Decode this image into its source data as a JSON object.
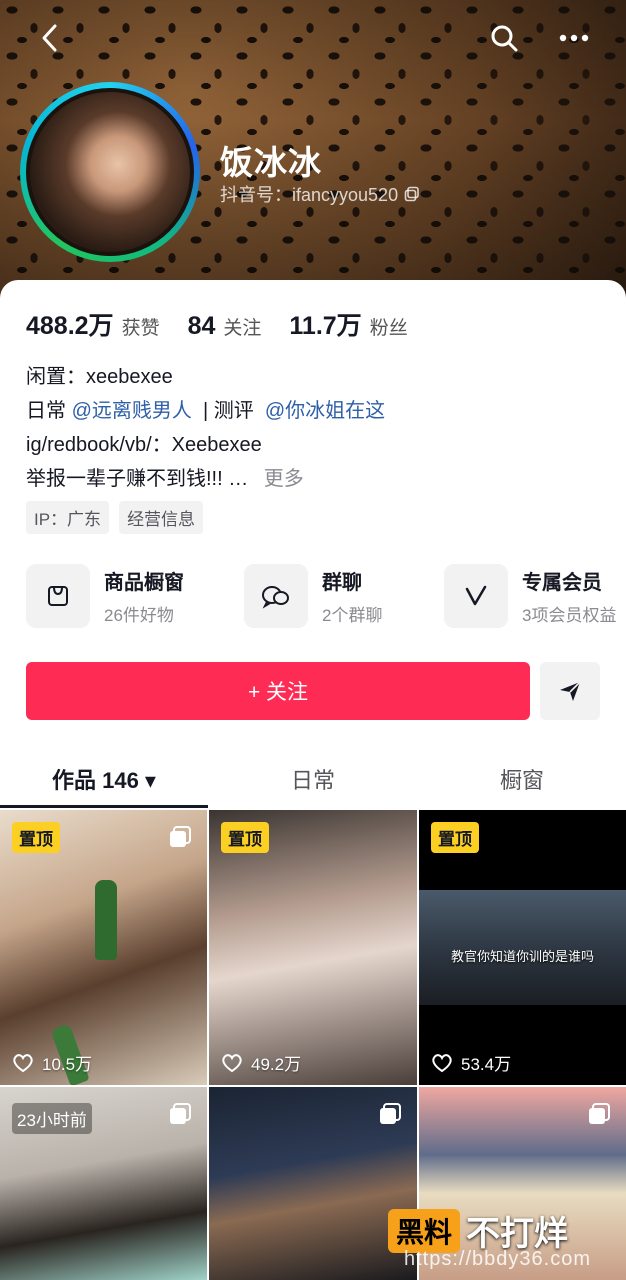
{
  "profile": {
    "nickname": "饭冰冰",
    "douyin_id": "抖音号：ifancyyou520"
  },
  "stats": [
    {
      "value": "488.2万",
      "label": "获赞"
    },
    {
      "value": "84",
      "label": "关注"
    },
    {
      "value": "11.7万",
      "label": "粉丝"
    }
  ],
  "bio": {
    "line1": "闲置：xeebexee",
    "line2_prefix": "日常",
    "line2_mention1": "@远离贱男人",
    "line2_mid": " | 测评 ",
    "line2_mention2": "@你冰姐在这",
    "line3": "ig/redbook/vb/：Xeebexee",
    "line4": "举报一辈子赚不到钱!!! …",
    "more": "更多"
  },
  "tags": [
    "IP：广东",
    "经营信息"
  ],
  "services": [
    {
      "title": "商品橱窗",
      "sub": "26件好物",
      "icon": "bag-icon"
    },
    {
      "title": "群聊",
      "sub": "2个群聊",
      "icon": "chat-bubbles-icon"
    },
    {
      "title": "专属会员",
      "sub": "3项会员权益",
      "icon": "v-icon"
    }
  ],
  "actions": {
    "follow": "+ 关注"
  },
  "tabs": [
    {
      "label": "作品 146 ▾",
      "active": true
    },
    {
      "label": "日常",
      "active": false
    },
    {
      "label": "橱窗",
      "active": false
    }
  ],
  "grid": {
    "tiles": [
      {
        "badge": "置顶",
        "likes": "10.5万"
      },
      {
        "badge": "置顶",
        "likes": "49.2万"
      },
      {
        "badge": "置顶",
        "likes": "53.4万",
        "caption": "教官你知道你训的是谁吗"
      },
      {
        "badge": "23小时前"
      },
      {},
      {}
    ]
  },
  "watermark": {
    "logo": "黑料",
    "text": "不打烊",
    "url": "https://bbdy36.com"
  },
  "colors": {
    "accent": "#fe2c55",
    "mention": "#2e5fa8",
    "pin": "#fbd023"
  }
}
